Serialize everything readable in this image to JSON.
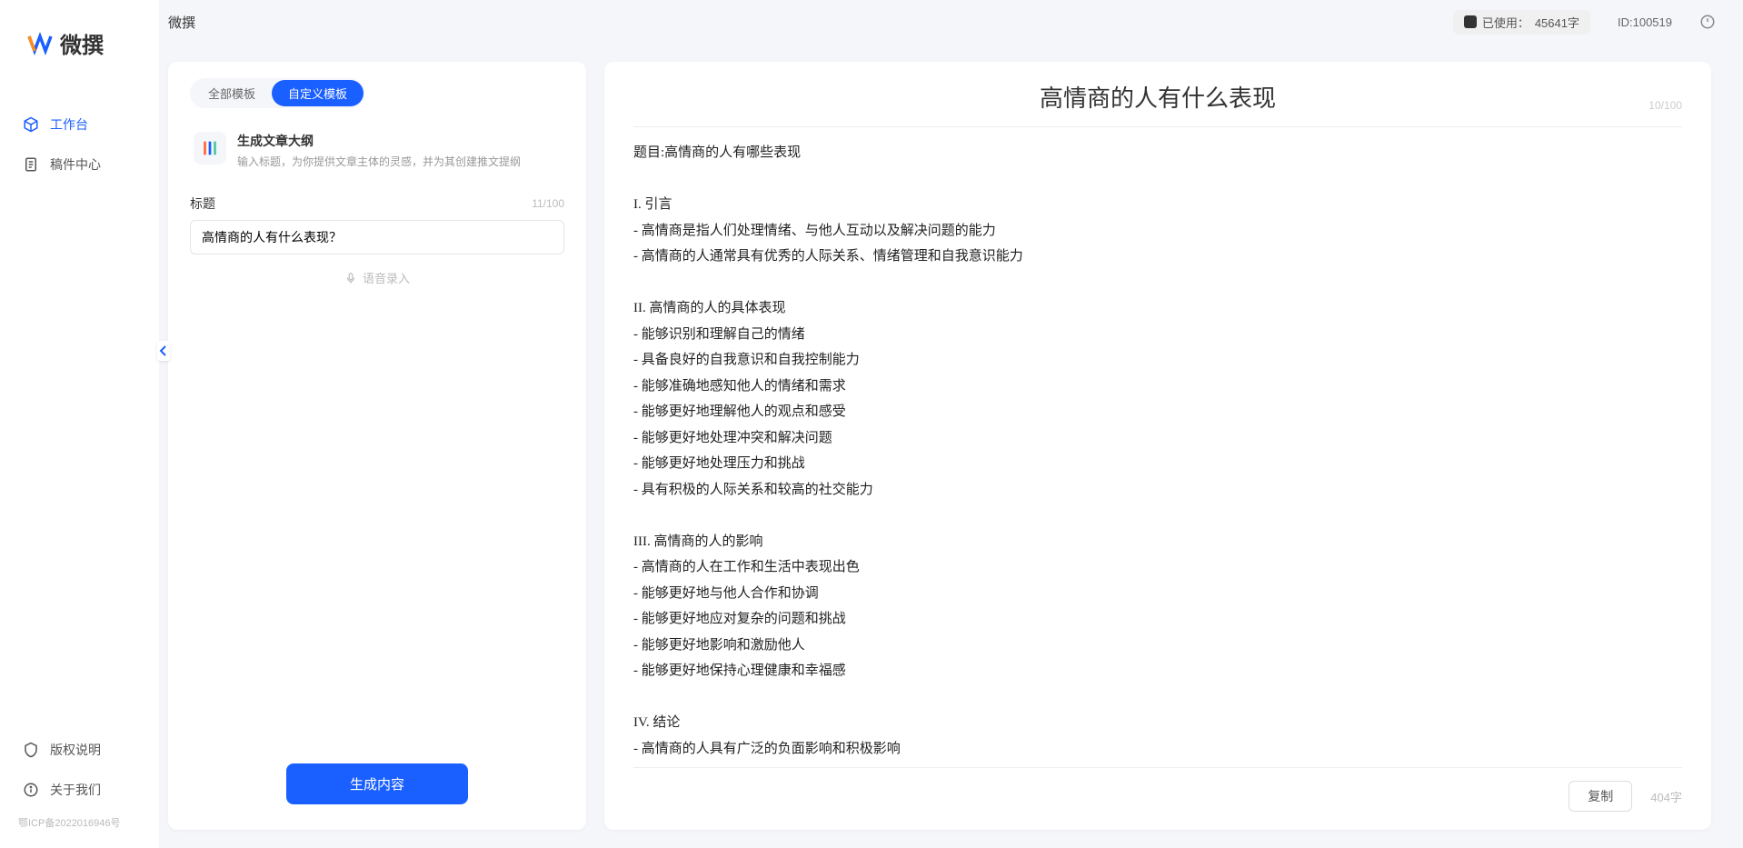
{
  "app_name": "微撰",
  "topbar": {
    "title": "微撰",
    "usage_label": "已使用：",
    "usage_value": "45641字",
    "uid_label": "ID:",
    "uid_value": "100519"
  },
  "sidebar": {
    "items": [
      {
        "label": "工作台",
        "icon": "cube-icon",
        "active": true
      },
      {
        "label": "稿件中心",
        "icon": "doc-icon",
        "active": false
      }
    ],
    "bottom": [
      {
        "label": "版权说明",
        "icon": "shield-icon"
      },
      {
        "label": "关于我们",
        "icon": "info-icon"
      }
    ],
    "footer": "鄂ICP备2022016946号"
  },
  "tabs": [
    {
      "label": "全部模板",
      "active": false
    },
    {
      "label": "自定义模板",
      "active": true
    }
  ],
  "template": {
    "title": "生成文章大纲",
    "desc": "输入标题，为你提供文章主体的灵感，并为其创建推文提纲"
  },
  "form": {
    "label": "标题",
    "char_count": "11/100",
    "value": "高情商的人有什么表现？",
    "voice_label": "语音录入"
  },
  "generate_label": "生成内容",
  "output": {
    "title": "高情商的人有什么表现",
    "header_count": "10/100",
    "body": "题目:高情商的人有哪些表现\n\nI. 引言\n- 高情商是指人们处理情绪、与他人互动以及解决问题的能力\n- 高情商的人通常具有优秀的人际关系、情绪管理和自我意识能力\n\nII. 高情商的人的具体表现\n- 能够识别和理解自己的情绪\n- 具备良好的自我意识和自我控制能力\n- 能够准确地感知他人的情绪和需求\n- 能够更好地理解他人的观点和感受\n- 能够更好地处理冲突和解决问题\n- 能够更好地处理压力和挑战\n- 具有积极的人际关系和较高的社交能力\n\nIII. 高情商的人的影响\n- 高情商的人在工作和生活中表现出色\n- 能够更好地与他人合作和协调\n- 能够更好地应对复杂的问题和挑战\n- 能够更好地影响和激励他人\n- 能够更好地保持心理健康和幸福感\n\nIV. 结论\n- 高情商的人具有广泛的负面影响和积极影响\n- 高情商的能力是可以通过学习和练习获得的\n- 培养和提高高情商的能力对于个人的职业发展和生活质量至关重要。",
    "copy_label": "复制",
    "word_count": "404字"
  }
}
